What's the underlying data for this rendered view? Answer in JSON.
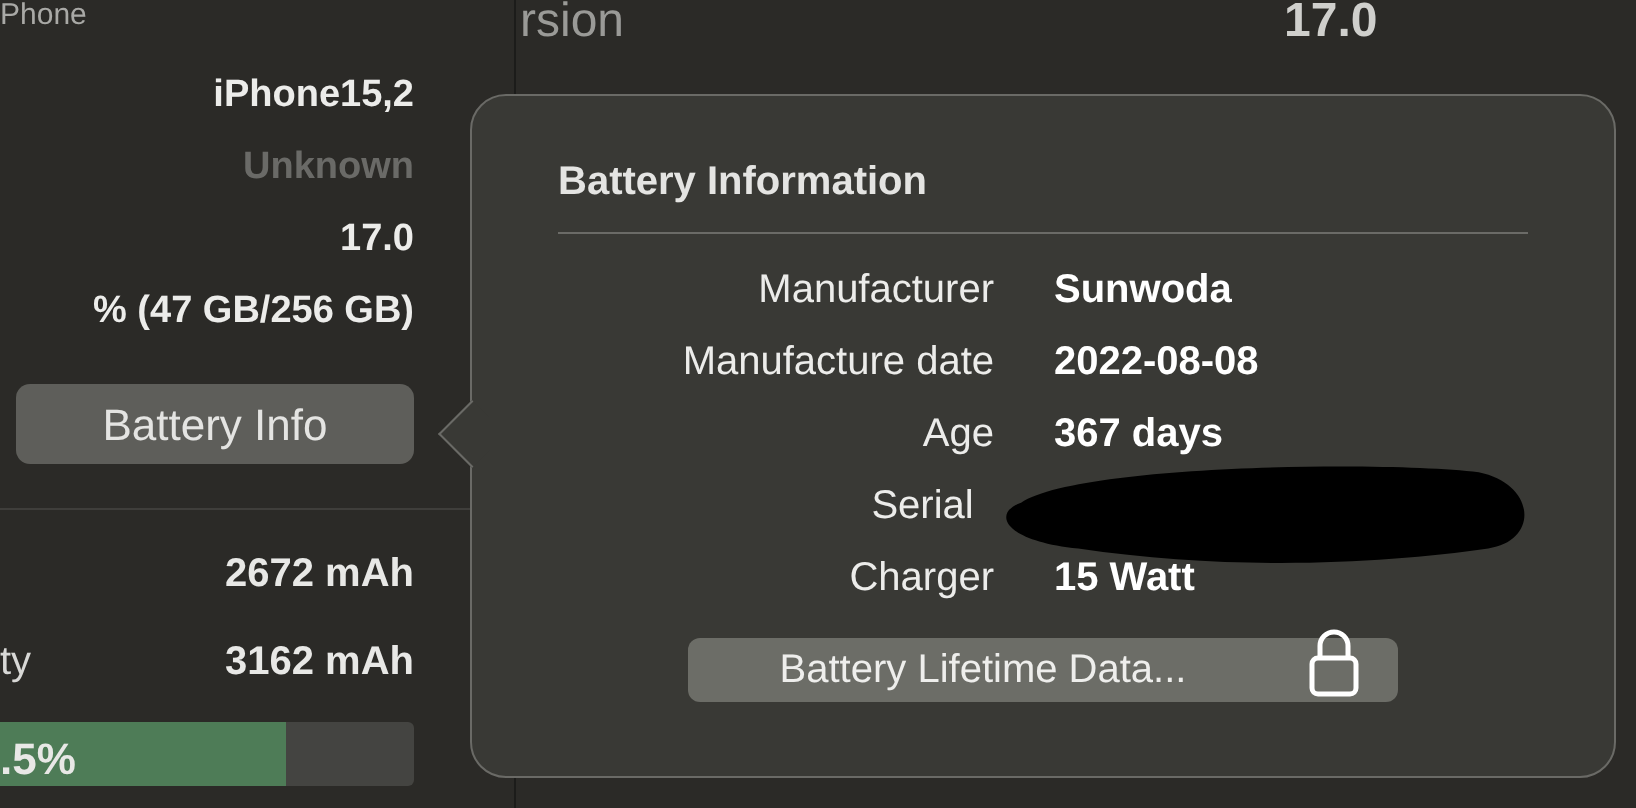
{
  "left_panel": {
    "header": "Phone",
    "values": [
      {
        "text": "iPhone15,2",
        "disabled": false
      },
      {
        "text": "Unknown",
        "disabled": true
      },
      {
        "text": "17.0",
        "disabled": false
      },
      {
        "text": "% (47 GB/256 GB)",
        "disabled": false
      }
    ],
    "button": "Battery Info",
    "battery_rows": [
      {
        "label": "",
        "value": "2672 mAh"
      },
      {
        "label": "ty",
        "value": "3162 mAh"
      }
    ],
    "health_bar": {
      "level": 0.69,
      "reading": ".5%"
    }
  },
  "right_panel": {
    "label": "rsion",
    "value": "17.0"
  },
  "popover": {
    "title": "Battery Information",
    "rows": [
      {
        "label": "Manufacturer",
        "value": "Sunwoda",
        "kind": "text"
      },
      {
        "label": "Manufacture date",
        "value": "2022-08-08",
        "kind": "text"
      },
      {
        "label": "Age",
        "value": "367 days",
        "kind": "text"
      },
      {
        "label": "Serial",
        "kind": "redacted"
      },
      {
        "label": "Charger",
        "value": "15 Watt",
        "kind": "text"
      }
    ],
    "button": "Battery Lifetime Data...",
    "locked": true
  }
}
